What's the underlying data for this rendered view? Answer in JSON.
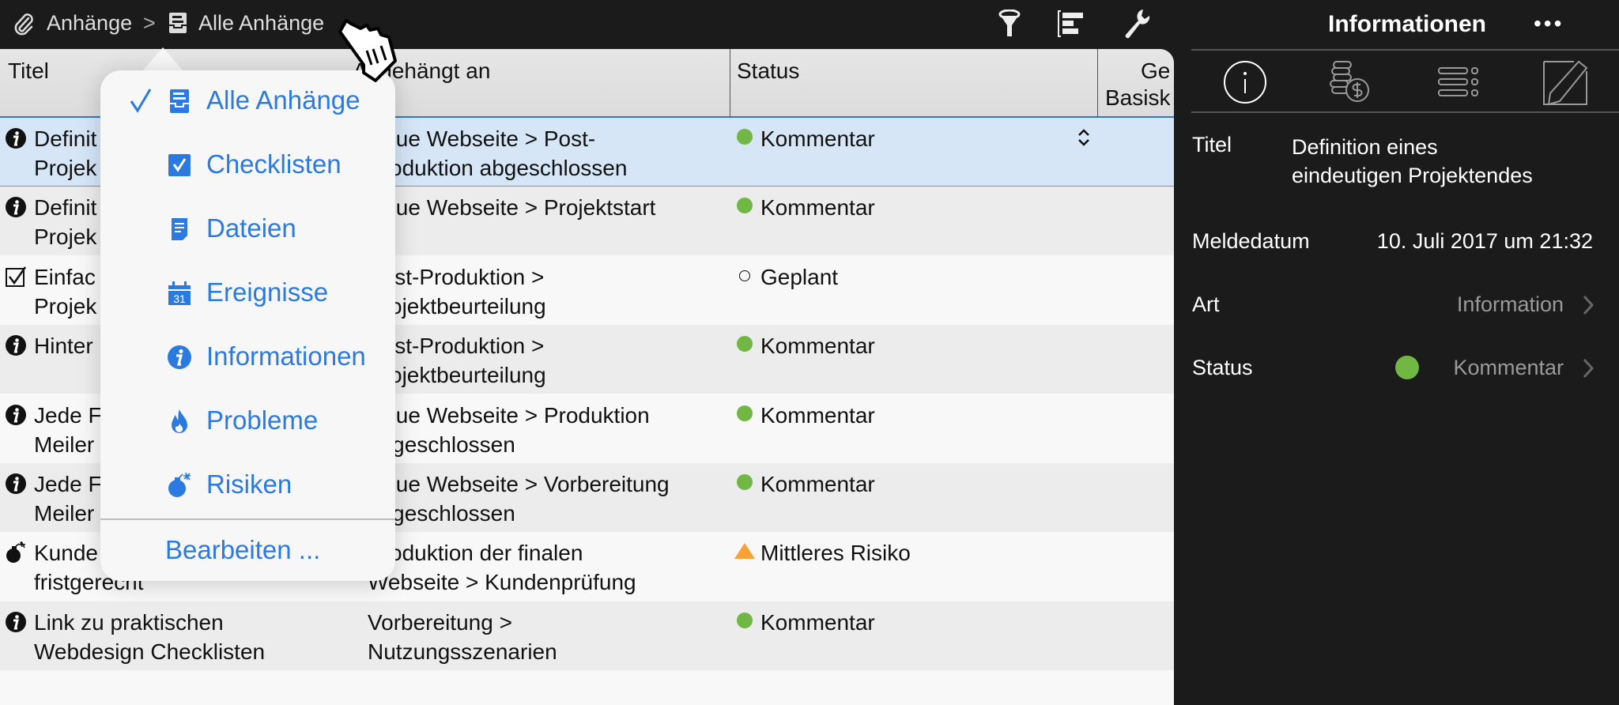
{
  "breadcrumb": {
    "root": "Anhänge",
    "separator": ">",
    "current": "Alle Anhänge"
  },
  "toolbar": {
    "icons": [
      "filter-icon",
      "gantt-icon",
      "wrench-icon"
    ]
  },
  "table": {
    "columns": [
      "Titel",
      "Angehängt an",
      "Status",
      "Ge",
      "Basisk"
    ],
    "rows": [
      {
        "icon": "info",
        "title": "Definit\nProjek",
        "attached": "Neue Webseite > Post-\nProduktion abgeschlossen",
        "status": "Kommentar",
        "status_type": "green",
        "selected": true
      },
      {
        "icon": "info",
        "title": "Definit\nProjek",
        "attached": "Neue Webseite > Projektstart",
        "status": "Kommentar",
        "status_type": "green"
      },
      {
        "icon": "check",
        "title": "Einfac\nProjek",
        "attached": "Post-Produktion >\nProjektbeurteilung",
        "status": "Geplant",
        "status_type": "open"
      },
      {
        "icon": "info",
        "title": "Hinter",
        "attached": "Post-Produktion >\nProjektbeurteilung",
        "status": "Kommentar",
        "status_type": "green"
      },
      {
        "icon": "info",
        "title": "Jede F\nMeiler",
        "attached": "Neue Webseite > Produktion\nabgeschlossen",
        "status": "Kommentar",
        "status_type": "green"
      },
      {
        "icon": "info",
        "title": "Jede F\nMeiler",
        "attached": "Neue Webseite > Vorbereitung\nabgeschlossen",
        "status": "Kommentar",
        "status_type": "green"
      },
      {
        "icon": "bomb",
        "title": "Kunde\nfristgerecht",
        "attached": "Produktion der finalen\nWebseite > Kundenprüfung",
        "status": "Mittleres Risiko",
        "status_type": "triangle"
      },
      {
        "icon": "info",
        "title": "Link zu praktischen\nWebdesign Checklisten",
        "attached": "Vorbereitung >\nNutzungsszenarien",
        "status": "Kommentar",
        "status_type": "green"
      }
    ]
  },
  "menu": {
    "items": [
      {
        "label": "Alle Anhänge",
        "icon": "tray-icon",
        "checked": true
      },
      {
        "label": "Checklisten",
        "icon": "checkbox-icon"
      },
      {
        "label": "Dateien",
        "icon": "document-icon"
      },
      {
        "label": "Ereignisse",
        "icon": "calendar-icon"
      },
      {
        "label": "Informationen",
        "icon": "info-icon"
      },
      {
        "label": "Probleme",
        "icon": "flame-icon"
      },
      {
        "label": "Risiken",
        "icon": "bomb-icon"
      }
    ],
    "edit_label": "Bearbeiten ...",
    "calendar_day": "31"
  },
  "inspector": {
    "title": "Informationen",
    "more": "•••",
    "tabs": [
      "info-icon",
      "coins-icon",
      "list-icon",
      "edit-icon"
    ],
    "fields": {
      "title_label": "Titel",
      "title_value": "Definition eines\neindeutigen Projektendes",
      "date_label": "Meldedatum",
      "date_value": "10. Juli 2017 um 21:32",
      "kind_label": "Art",
      "kind_value": "Information",
      "status_label": "Status",
      "status_value": "Kommentar"
    }
  },
  "colors": {
    "accent": "#2a7ae2",
    "green": "#70b843",
    "orange": "#f7a234",
    "selection": "#d6e6f7"
  }
}
